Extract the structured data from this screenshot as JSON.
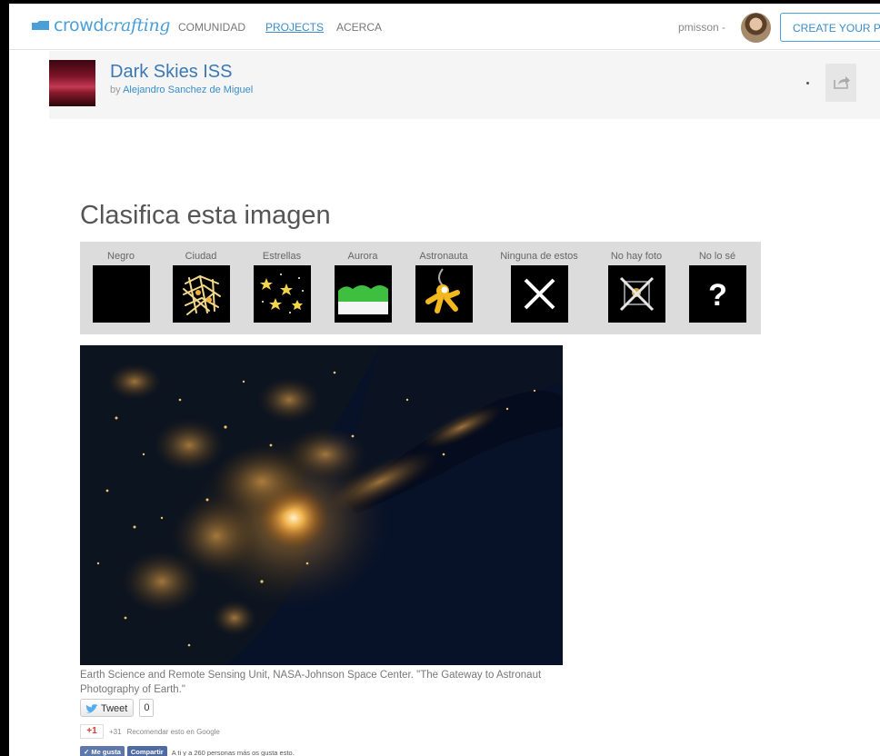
{
  "nav": {
    "logo_plain": "crowd",
    "logo_script": "crafting",
    "links": [
      {
        "label": "COMUNIDAD",
        "active": false
      },
      {
        "label": "PROJECTS",
        "active": true
      },
      {
        "label": "ACERCA",
        "active": false
      }
    ],
    "user": "pmisson -",
    "create_button": "CREATE YOUR PRO"
  },
  "project": {
    "title": "Dark Skies ISS",
    "by_prefix": "by",
    "author": "Alejandro Sanchez de Miguel"
  },
  "task": {
    "heading": "Clasifica esta imagen",
    "categories": [
      {
        "label": "Negro",
        "icon": "black-square-icon"
      },
      {
        "label": "Ciudad",
        "icon": "city-icon"
      },
      {
        "label": "Estrellas",
        "icon": "stars-icon"
      },
      {
        "label": "Aurora",
        "icon": "aurora-icon"
      },
      {
        "label": "Astronauta",
        "icon": "astronaut-icon"
      },
      {
        "label": "Ninguna de estos",
        "icon": "x-icon"
      },
      {
        "label": "No hay foto",
        "icon": "no-photo-icon"
      },
      {
        "label": "No lo sé",
        "icon": "question-icon"
      }
    ],
    "caption": "Earth Science and Remote Sensing Unit, NASA-Johnson Space Center. \"The Gateway to Astronaut Photography of Earth.\""
  },
  "social": {
    "tweet_label": "Tweet",
    "tweet_count": "0",
    "gplus_label": "+1",
    "gplus_count": "+31",
    "gplus_text": "Recomendar esto en Google",
    "fb_like": "Me gusta",
    "fb_share": "Compartir",
    "fb_text": "A ti y a 260 personas más os gusta esto."
  },
  "colors": {
    "accent": "#3b8dc7",
    "category_bar": "#dcdcdc",
    "photo_background": "#061026",
    "city_lights": "#f0b24a"
  }
}
